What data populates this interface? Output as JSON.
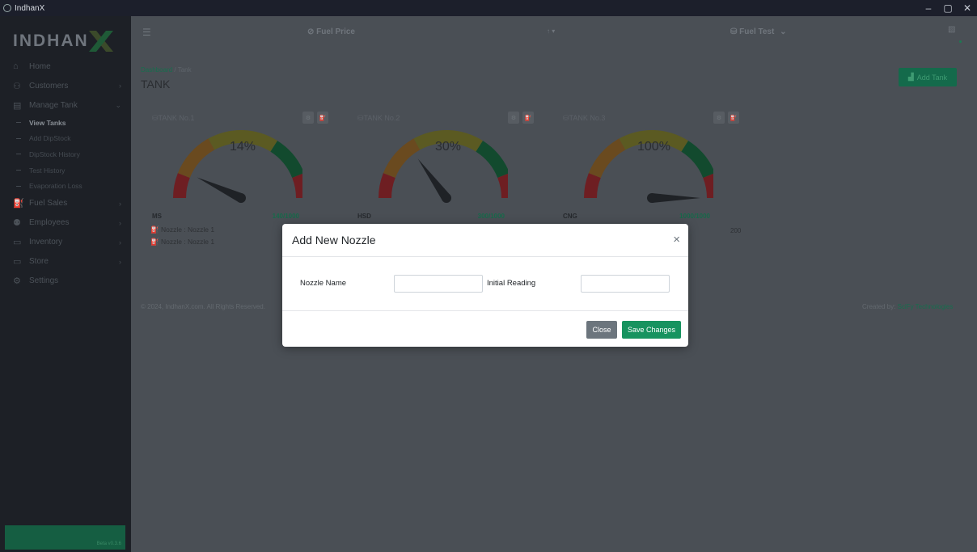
{
  "window": {
    "title": "IndhanX",
    "minimize": "–",
    "maximize": "▢",
    "close": "✕"
  },
  "brand": {
    "logo_text": "INDHAN",
    "logo_accent": "X"
  },
  "sidebar": {
    "items": [
      {
        "label": "Home",
        "icon": "home-icon",
        "glyph": "⌂",
        "chevron": ""
      },
      {
        "label": "Customers",
        "icon": "users-icon",
        "glyph": "⚇",
        "chevron": "›"
      },
      {
        "label": "Manage Tank",
        "icon": "tank-icon",
        "glyph": "▤",
        "chevron": "⌄"
      }
    ],
    "subitems": [
      {
        "label": "View Tanks",
        "active": true
      },
      {
        "label": "Add DipStock",
        "active": false
      },
      {
        "label": "DipStock History",
        "active": false
      },
      {
        "label": "Test History",
        "active": false
      },
      {
        "label": "Evaporation Loss",
        "active": false
      }
    ],
    "items2": [
      {
        "label": "Fuel Sales",
        "icon": "fuel-pump-icon",
        "glyph": "⛽",
        "chevron": "›"
      },
      {
        "label": "Employees",
        "icon": "employees-icon",
        "glyph": "⚉",
        "chevron": "›"
      },
      {
        "label": "Inventory",
        "icon": "inventory-icon",
        "glyph": "▭",
        "chevron": "›"
      },
      {
        "label": "Store",
        "icon": "store-icon",
        "glyph": "▭",
        "chevron": "›"
      },
      {
        "label": "Settings",
        "icon": "gear-icon",
        "glyph": "⚙",
        "chevron": ""
      }
    ],
    "version": "Beta v0.3.6"
  },
  "header": {
    "fuel_price_label": "Fuel Price",
    "hamburger": "☰",
    "arrow": "↑ ▾",
    "fuel_test_label": "Fuel Test",
    "fuel_test_chevron": "⌄"
  },
  "breadcrumb": {
    "root": "Dashboard",
    "sep": "/",
    "current": "Tank"
  },
  "page_title": "TANK",
  "add_tank_label": "Add Tank",
  "tanks": [
    {
      "name": "TANK No.1",
      "percent_label": "14%",
      "level": 0.14,
      "fuel": "MS",
      "reading": "140/1000",
      "nozzles": [
        "Nozzle : Nozzle 1",
        "Nozzle : Nozzle 1"
      ]
    },
    {
      "name": "TANK No.2",
      "percent_label": "30%",
      "level": 0.3,
      "fuel": "HSD",
      "reading": "300/1000",
      "nozzles": []
    },
    {
      "name": "TANK No.3",
      "percent_label": "100%",
      "level": 1.0,
      "fuel": "CNG",
      "reading": "1000/1000",
      "nozzles": []
    }
  ],
  "stock_value": "200",
  "footer": {
    "copyright": "© 2024, IndhanX.com. All Rights Reserved.",
    "credit_prefix": "Created by:",
    "credit_link": "SciFy Technologies"
  },
  "modal": {
    "title": "Add New Nozzle",
    "close_x": "×",
    "fields": {
      "nozzle_name_label": "Nozzle Name",
      "nozzle_name_value": "",
      "initial_reading_label": "Initial Reading",
      "initial_reading_value": ""
    },
    "close_button": "Close",
    "save_button": "Save Changes"
  },
  "colors": {
    "gauge_red": "#6e1e22",
    "gauge_orange": "#6a4a1f",
    "gauge_yellow": "#5b5a22",
    "gauge_green": "#124a2e",
    "needle": "#1f2226",
    "accent_green": "#17935f"
  }
}
